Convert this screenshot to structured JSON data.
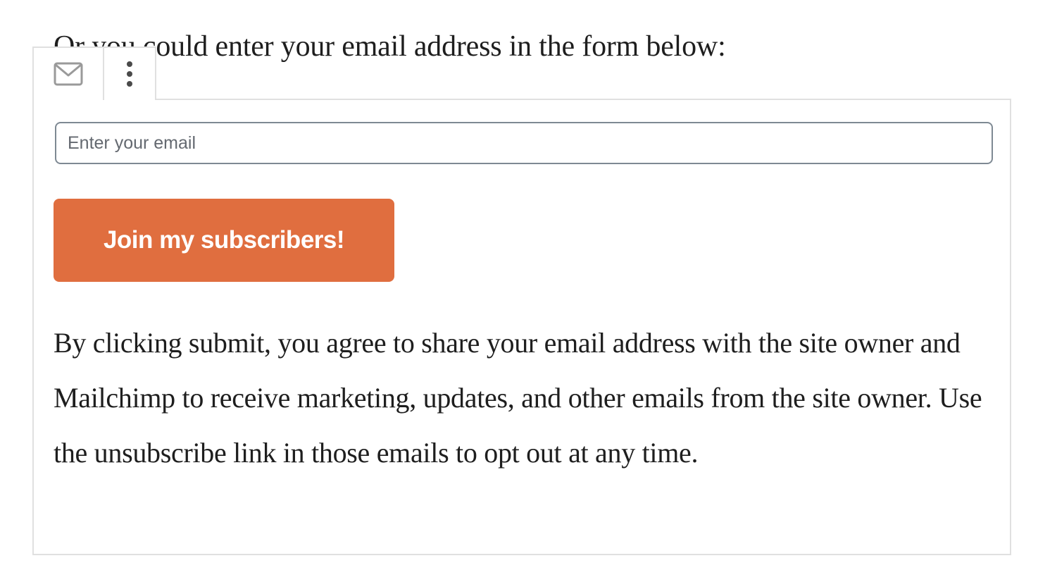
{
  "intro_text": "Or you could enter your email address in the form below:",
  "toolbar": {
    "icons": [
      "envelope-icon",
      "vertical-ellipsis-icon"
    ]
  },
  "form": {
    "email_placeholder": "Enter your email",
    "email_value": "",
    "submit_label": "Join my subscribers!",
    "disclaimer": "By clicking submit, you agree to share your email address with the site owner and Mailchimp to receive marketing, updates, and other emails from the site owner. Use the unsubscribe link in those emails to opt out at any time."
  },
  "colors": {
    "button_background": "#e06e3f",
    "button_text": "#ffffff",
    "input_border": "#7e8993",
    "block_border": "#e0e0e0"
  }
}
